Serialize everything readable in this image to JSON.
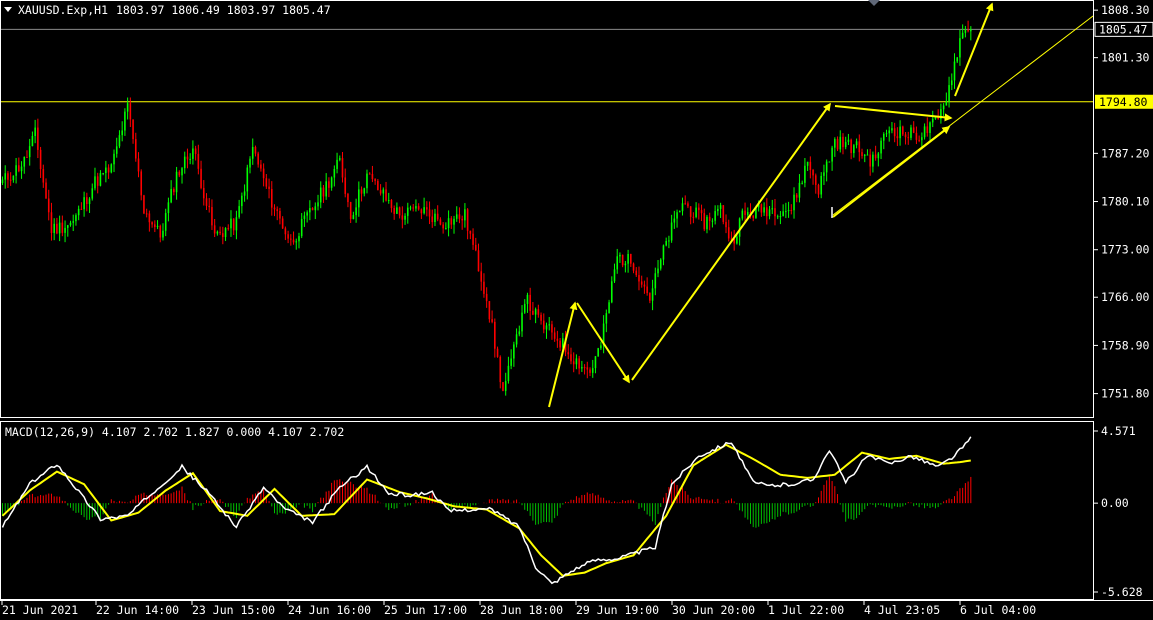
{
  "chart_data": [
    {
      "type": "candlestick",
      "symbol_header": "XAUUSD.Exp,H1",
      "ohlc_header": "1803.97 1806.49 1803.97 1805.47",
      "last_price_label": "1805.47",
      "level_label": "1794.80",
      "level_value": 1794.8,
      "last_value": 1805.47,
      "ylim": [
        1748.5,
        1809.5
      ],
      "y_ticks": [
        "1808.30",
        "1801.30",
        "1787.20",
        "1780.10",
        "1773.00",
        "1766.00",
        "1758.90",
        "1751.80"
      ],
      "x_ticks": [
        "21 Jun 2021",
        "22 Jun 14:00",
        "23 Jun 15:00",
        "24 Jun 16:00",
        "25 Jun 17:00",
        "28 Jun 18:00",
        "29 Jun 19:00",
        "30 Jun 20:00",
        "1 Jul 22:00",
        "4 Jul 23:05",
        "6 Jul 04:00"
      ],
      "up_color": "#00ff00",
      "down_color": "#ff0000",
      "level_color": "#ffff00",
      "arrow_color": "#ffff00",
      "anchors": [
        [
          0,
          1783
        ],
        [
          8,
          1786
        ],
        [
          12,
          1790
        ],
        [
          18,
          1776
        ],
        [
          26,
          1777
        ],
        [
          34,
          1783
        ],
        [
          40,
          1785
        ],
        [
          46,
          1794
        ],
        [
          52,
          1779
        ],
        [
          58,
          1775
        ],
        [
          64,
          1784
        ],
        [
          70,
          1788
        ],
        [
          78,
          1775
        ],
        [
          86,
          1777
        ],
        [
          92,
          1788
        ],
        [
          98,
          1781
        ],
        [
          106,
          1774
        ],
        [
          114,
          1779
        ],
        [
          124,
          1786
        ],
        [
          128,
          1778
        ],
        [
          134,
          1784
        ],
        [
          140,
          1781
        ],
        [
          146,
          1778
        ],
        [
          154,
          1779
        ],
        [
          162,
          1777
        ],
        [
          170,
          1778
        ],
        [
          178,
          1766
        ],
        [
          184,
          1752
        ],
        [
          188,
          1758
        ],
        [
          192,
          1766
        ],
        [
          198,
          1762
        ],
        [
          204,
          1760
        ],
        [
          210,
          1757
        ],
        [
          216,
          1755
        ],
        [
          220,
          1759
        ],
        [
          226,
          1772
        ],
        [
          232,
          1771
        ],
        [
          238,
          1766
        ],
        [
          244,
          1774
        ],
        [
          250,
          1780
        ],
        [
          258,
          1777
        ],
        [
          264,
          1779
        ],
        [
          268,
          1774
        ],
        [
          272,
          1778
        ],
        [
          280,
          1779
        ],
        [
          290,
          1779
        ],
        [
          296,
          1786
        ],
        [
          300,
          1782
        ],
        [
          306,
          1789
        ],
        [
          314,
          1788
        ],
        [
          320,
          1786
        ],
        [
          326,
          1791
        ],
        [
          332,
          1790
        ],
        [
          338,
          1790
        ],
        [
          344,
          1792
        ],
        [
          348,
          1797
        ],
        [
          352,
          1804
        ],
        [
          355,
          1806
        ]
      ]
    },
    {
      "type": "macd",
      "header": "MACD(12,26,9) 4.107 2.702 1.827 0.000 4.107 2.702",
      "ylim": [
        -5.628,
        4.571
      ],
      "y_ticks": [
        "4.571",
        "0.00",
        "-5.628"
      ],
      "macd_color": "#ffffff",
      "signal_color": "#ffff00",
      "hist_pos_color": "#ff0000",
      "hist_neg_color": "#00c000",
      "anchors_macd": [
        [
          0,
          -1.5
        ],
        [
          10,
          1.2
        ],
        [
          20,
          2.5
        ],
        [
          30,
          0.3
        ],
        [
          36,
          -1.0
        ],
        [
          46,
          -0.8
        ],
        [
          56,
          0.8
        ],
        [
          66,
          2.3
        ],
        [
          76,
          0.6
        ],
        [
          86,
          -1.5
        ],
        [
          96,
          1.0
        ],
        [
          104,
          -0.4
        ],
        [
          114,
          -1.2
        ],
        [
          124,
          1.0
        ],
        [
          134,
          2.3
        ],
        [
          142,
          0.6
        ],
        [
          150,
          0.5
        ],
        [
          158,
          0.7
        ],
        [
          164,
          -0.5
        ],
        [
          172,
          -0.4
        ],
        [
          180,
          -0.4
        ],
        [
          190,
          -1.5
        ],
        [
          196,
          -4.0
        ],
        [
          202,
          -5.1
        ],
        [
          210,
          -4.2
        ],
        [
          218,
          -3.6
        ],
        [
          226,
          -3.5
        ],
        [
          232,
          -3.2
        ],
        [
          240,
          -2.8
        ],
        [
          246,
          1.2
        ],
        [
          256,
          3.0
        ],
        [
          268,
          3.9
        ],
        [
          276,
          1.3
        ],
        [
          282,
          1.1
        ],
        [
          290,
          1.2
        ],
        [
          298,
          1.5
        ],
        [
          304,
          3.4
        ],
        [
          310,
          1.3
        ],
        [
          318,
          3.0
        ],
        [
          326,
          2.5
        ],
        [
          334,
          3.0
        ],
        [
          344,
          2.3
        ],
        [
          350,
          3.0
        ],
        [
          356,
          4.1
        ]
      ],
      "anchors_signal": [
        [
          0,
          -0.8
        ],
        [
          10,
          0.8
        ],
        [
          20,
          2.0
        ],
        [
          30,
          1.2
        ],
        [
          40,
          -1.1
        ],
        [
          50,
          -0.6
        ],
        [
          60,
          0.8
        ],
        [
          70,
          1.9
        ],
        [
          80,
          -0.5
        ],
        [
          90,
          -0.8
        ],
        [
          100,
          0.9
        ],
        [
          110,
          -0.8
        ],
        [
          122,
          -0.7
        ],
        [
          134,
          1.5
        ],
        [
          146,
          0.7
        ],
        [
          156,
          0.3
        ],
        [
          166,
          -0.2
        ],
        [
          178,
          -0.4
        ],
        [
          190,
          -1.6
        ],
        [
          198,
          -3.3
        ],
        [
          206,
          -4.6
        ],
        [
          214,
          -4.4
        ],
        [
          222,
          -3.8
        ],
        [
          232,
          -3.3
        ],
        [
          244,
          -0.8
        ],
        [
          254,
          2.4
        ],
        [
          266,
          3.7
        ],
        [
          276,
          2.8
        ],
        [
          286,
          1.8
        ],
        [
          296,
          1.6
        ],
        [
          306,
          1.8
        ],
        [
          316,
          3.2
        ],
        [
          326,
          2.8
        ],
        [
          336,
          3.0
        ],
        [
          346,
          2.5
        ],
        [
          352,
          2.6
        ],
        [
          356,
          2.7
        ]
      ]
    }
  ]
}
